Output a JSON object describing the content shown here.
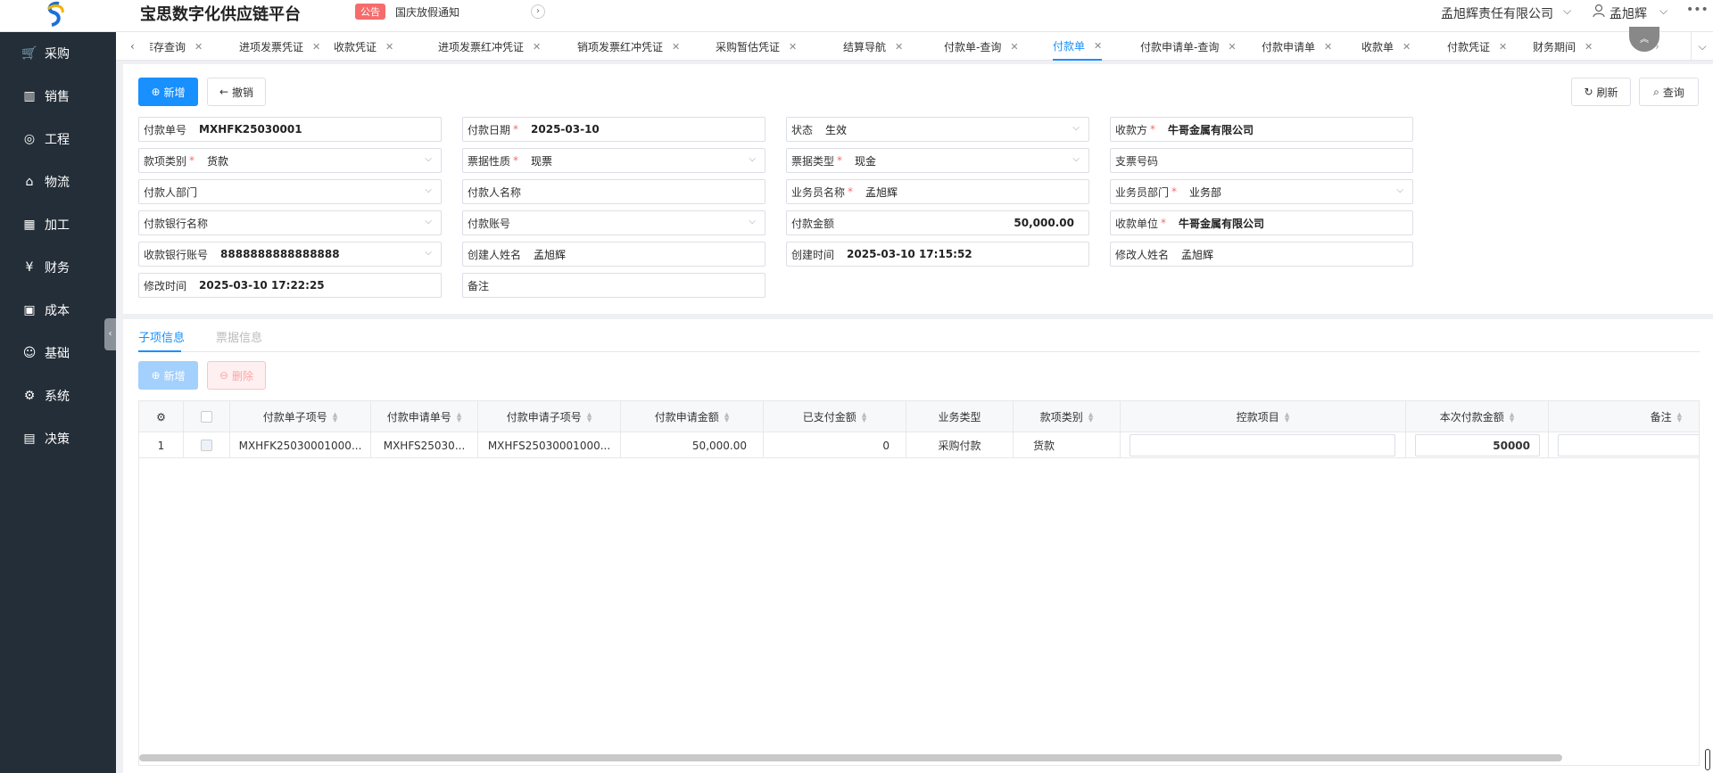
{
  "header": {
    "title": "宝思数字化供应链平台",
    "notice_badge": "公告",
    "notice_text": "国庆放假通知",
    "company": "孟旭辉责任有限公司",
    "user": "孟旭辉"
  },
  "sidebar": {
    "items": [
      {
        "label": "采购",
        "icon": "cart-icon"
      },
      {
        "label": "销售",
        "icon": "bar-chart-icon"
      },
      {
        "label": "工程",
        "icon": "compass-icon"
      },
      {
        "label": "物流",
        "icon": "home-icon"
      },
      {
        "label": "加工",
        "icon": "calculator-icon"
      },
      {
        "label": "财务",
        "icon": "yen-icon"
      },
      {
        "label": "成本",
        "icon": "box-icon"
      },
      {
        "label": "基础",
        "icon": "smile-icon"
      },
      {
        "label": "系统",
        "icon": "gear-icon"
      },
      {
        "label": "决策",
        "icon": "line-chart-icon"
      }
    ]
  },
  "tabs": [
    {
      "label": "库存查询",
      "active": false
    },
    {
      "label": "进项发票凭证",
      "active": false
    },
    {
      "label": "收款凭证",
      "active": false
    },
    {
      "label": "进项发票红冲凭证",
      "active": false
    },
    {
      "label": "销项发票红冲凭证",
      "active": false
    },
    {
      "label": "采购暂估凭证",
      "active": false
    },
    {
      "label": "结算导航",
      "active": false
    },
    {
      "label": "付款单-查询",
      "active": false
    },
    {
      "label": "付款单",
      "active": true
    },
    {
      "label": "付款申请单-查询",
      "active": false
    },
    {
      "label": "付款申请单",
      "active": false
    },
    {
      "label": "收款单",
      "active": false
    },
    {
      "label": "付款凭证",
      "active": false
    },
    {
      "label": "财务期间",
      "active": false
    }
  ],
  "toolbar": {
    "add": "新增",
    "cancel": "撤销",
    "refresh": "刷新",
    "query": "查询"
  },
  "form": {
    "pay_no": {
      "label": "付款单号",
      "value": "MXHFK25030001"
    },
    "pay_date": {
      "label": "付款日期",
      "value": "2025-03-10"
    },
    "status": {
      "label": "状态",
      "value": "生效"
    },
    "payee": {
      "label": "收款方",
      "value": "牛哥金属有限公司"
    },
    "fund_type": {
      "label": "款项类别",
      "value": "货款"
    },
    "bill_nature": {
      "label": "票据性质",
      "value": "现票"
    },
    "bill_type": {
      "label": "票据类型",
      "value": "现金"
    },
    "cheque_no": {
      "label": "支票号码",
      "value": ""
    },
    "payer_dept": {
      "label": "付款人部门",
      "value": ""
    },
    "payer_name": {
      "label": "付款人名称",
      "value": ""
    },
    "salesman_name": {
      "label": "业务员名称",
      "value": "孟旭辉"
    },
    "salesman_dept": {
      "label": "业务员部门",
      "value": "业务部"
    },
    "pay_bank": {
      "label": "付款银行名称",
      "value": ""
    },
    "pay_account": {
      "label": "付款账号",
      "value": ""
    },
    "pay_amount": {
      "label": "付款金额",
      "value": "50,000.00"
    },
    "receive_unit": {
      "label": "收款单位",
      "value": "牛哥金属有限公司"
    },
    "receive_account": {
      "label": "收款银行账号",
      "value": "8888888888888888"
    },
    "creator": {
      "label": "创建人姓名",
      "value": "孟旭辉"
    },
    "create_time": {
      "label": "创建时间",
      "value": "2025-03-10 17:15:52"
    },
    "modifier": {
      "label": "修改人姓名",
      "value": "孟旭辉"
    },
    "modify_time": {
      "label": "修改时间",
      "value": "2025-03-10 17:22:25"
    },
    "remark": {
      "label": "备注",
      "value": ""
    }
  },
  "detail": {
    "tab_items": "子项信息",
    "tab_bills": "票据信息",
    "add": "新增",
    "delete": "删除",
    "columns": [
      "付款单子项号",
      "付款申请单号",
      "付款申请子项号",
      "付款申请金额",
      "已支付金额",
      "业务类型",
      "款项类别",
      "控款项目",
      "本次付款金额",
      "备注"
    ],
    "rows": [
      {
        "index": "1",
        "item_no": "MXHFK25030001000...",
        "apply_no": "MXHFS25030...",
        "apply_item_no": "MXHFS25030001000...",
        "apply_amount": "50,000.00",
        "paid_amount": "0",
        "biz_type": "采购付款",
        "fund_type": "货款",
        "control_item": "",
        "this_amount": "50000",
        "remark": ""
      }
    ]
  },
  "colors": {
    "primary": "#1890ff",
    "sidebar_bg": "#242e38",
    "danger": "#f56c6c"
  }
}
